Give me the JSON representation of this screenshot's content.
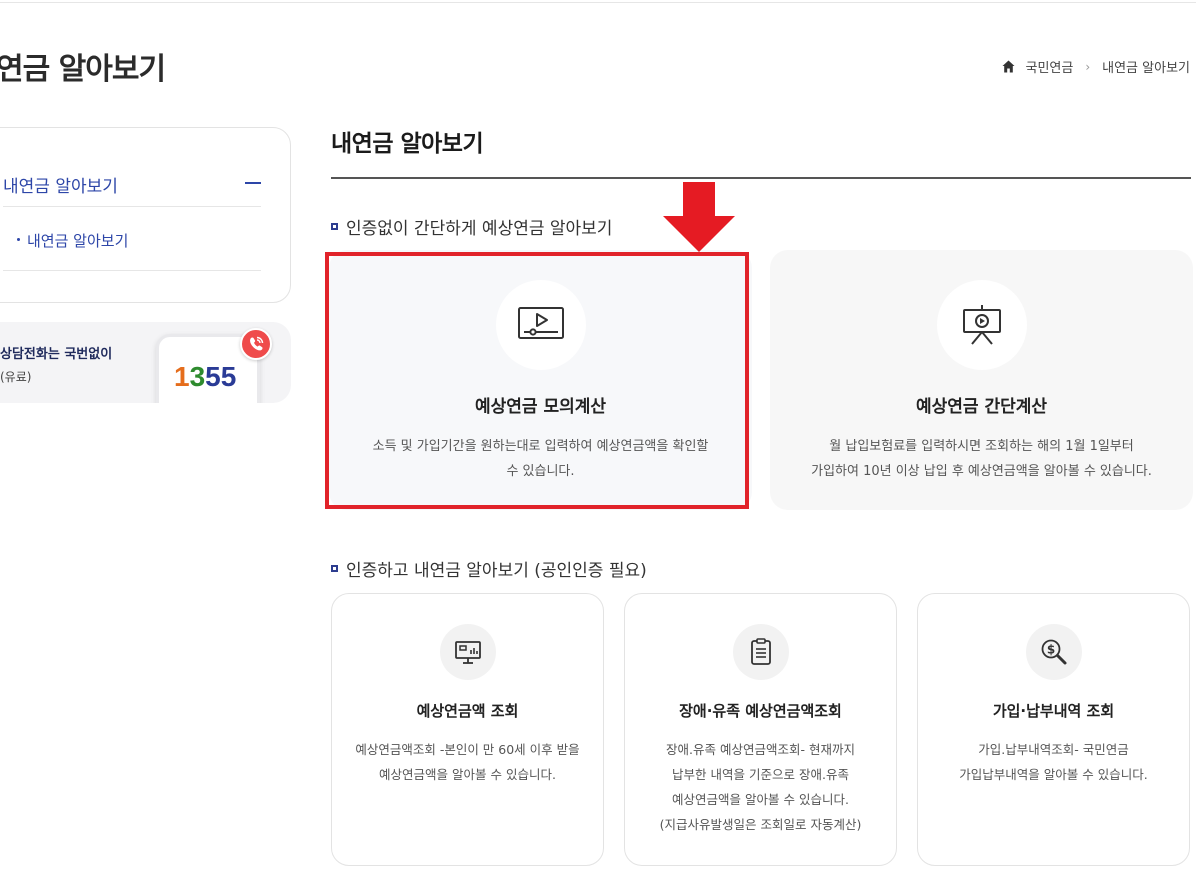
{
  "page": {
    "title": "연금 알아보기"
  },
  "breadcrumb": {
    "home_icon": "home-icon",
    "items": [
      "국민연금",
      "내연금 알아보기"
    ]
  },
  "sidebar": {
    "menu_head": "내연금 알아보기",
    "sub_item": "내연금 알아보기",
    "call": {
      "title": "상담전화는 국번없이",
      "sub": "(유료)",
      "number_parts": [
        "1",
        "3",
        "5",
        "5"
      ]
    }
  },
  "main": {
    "title": "내연금 알아보기",
    "section1": {
      "heading": "인증없이 간단하게 예상연금 알아보기",
      "cards": [
        {
          "icon": "video-monitor-icon",
          "title": "예상연금 모의계산",
          "desc_lines": [
            "소득 및 가입기간을 원하는대로 입력하여 예상연금액을 확인할",
            "수 있습니다."
          ]
        },
        {
          "icon": "presentation-board-icon",
          "title": "예상연금 간단계산",
          "desc_lines": [
            "월 납입보험료를 입력하시면 조회하는 해의 1월 1일부터",
            "가입하여 10년 이상 납입 후 예상연금액을 알아볼 수 있습니다."
          ]
        }
      ]
    },
    "section2": {
      "heading": "인증하고 내연금 알아보기 (공인인증 필요)",
      "cards": [
        {
          "icon": "monitor-chart-icon",
          "title": "예상연금액 조회",
          "desc_lines": [
            "예상연금액조회 -본인이 만 60세 이후 받을",
            "예상연금액을 알아볼 수 있습니다."
          ]
        },
        {
          "icon": "clipboard-icon",
          "title": "장애·유족 예상연금액조회",
          "desc_lines": [
            "장애.유족 예상연금액조회- 현재까지",
            "납부한 내역을 기준으로 장애.유족",
            "예상연금액을 알아볼 수 있습니다.",
            "(지급사유발생일은 조회일로 자동계산)"
          ]
        },
        {
          "icon": "dollar-search-icon",
          "title": "가입·납부내역 조회",
          "desc_lines": [
            "가입.납부내역조회- 국민연금",
            "가입납부내역을 알아볼 수 있습니다."
          ]
        }
      ]
    }
  },
  "colors": {
    "accent": "#2d46a8",
    "highlight": "#e1232a"
  }
}
